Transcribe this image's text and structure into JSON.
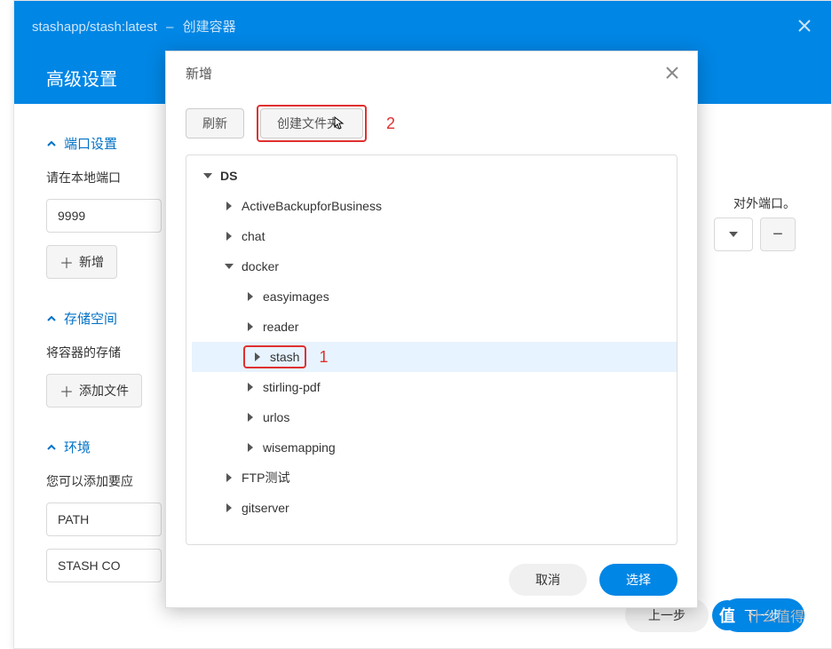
{
  "outer": {
    "image_name": "stashapp/stash:latest",
    "title_suffix": "创建容器",
    "advanced": "高级设置"
  },
  "sections": {
    "port": {
      "title": "端口设置",
      "desc_left": "请在本地端口",
      "desc_right": "对外端口。",
      "value": "9999",
      "add": "新增"
    },
    "storage": {
      "title": "存储空间",
      "desc": "将容器的存储",
      "add_file": "添加文件"
    },
    "env": {
      "title": "环境",
      "desc": "您可以添加要应",
      "row1": "PATH",
      "row2": "STASH  CO"
    }
  },
  "footer": {
    "prev": "上一步",
    "next": "下一步"
  },
  "watermark": {
    "text": "什么值得"
  },
  "dialog": {
    "title": "新增",
    "refresh": "刷新",
    "create_folder": "创建文件夹",
    "annot2": "2",
    "annot1": "1",
    "cancel": "取消",
    "select": "选择"
  },
  "tree": [
    {
      "label": "DS",
      "depth": 0,
      "open": true,
      "bold": true
    },
    {
      "label": "ActiveBackupforBusiness",
      "depth": 1,
      "open": false
    },
    {
      "label": "chat",
      "depth": 1,
      "open": false
    },
    {
      "label": "docker",
      "depth": 1,
      "open": true
    },
    {
      "label": "easyimages",
      "depth": 2,
      "open": false
    },
    {
      "label": "reader",
      "depth": 2,
      "open": false
    },
    {
      "label": "stash",
      "depth": 2,
      "open": false,
      "selected": true
    },
    {
      "label": "stirling-pdf",
      "depth": 2,
      "open": false
    },
    {
      "label": "urlos",
      "depth": 2,
      "open": false
    },
    {
      "label": "wisemapping",
      "depth": 2,
      "open": false
    },
    {
      "label": "FTP测试",
      "depth": 1,
      "open": false
    },
    {
      "label": "gitserver",
      "depth": 1,
      "open": false
    }
  ]
}
